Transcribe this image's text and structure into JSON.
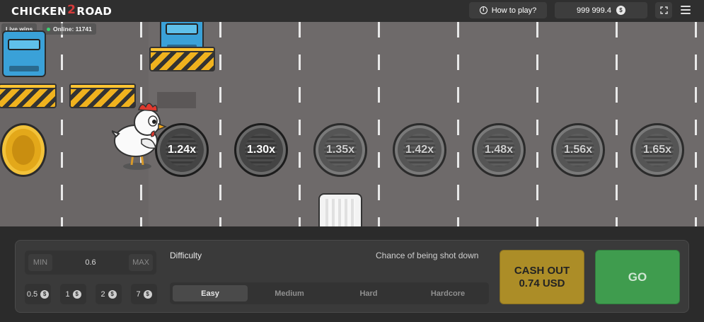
{
  "header": {
    "logo_part1": "CHICKEN",
    "logo_two": "2",
    "logo_part2": "ROAD",
    "how_to_play": "How to play?",
    "balance": "999 999.4",
    "currency_icon": "$"
  },
  "road": {
    "live_wins": "Live wins",
    "online": "Online: 11741",
    "multipliers": [
      "1.24x",
      "1.30x",
      "1.35x",
      "1.42x",
      "1.48x",
      "1.56x",
      "1.65x"
    ]
  },
  "panel": {
    "min_label": "MIN",
    "bet_value": "0.6",
    "max_label": "MAX",
    "quick_bets": [
      "0.5",
      "1",
      "2",
      "7"
    ],
    "difficulty_title": "Difficulty",
    "chance_label": "Chance of being shot down",
    "difficulties": [
      "Easy",
      "Medium",
      "Hard",
      "Hardcore"
    ],
    "selected_difficulty": "Easy",
    "cashout_line1": "CASH OUT",
    "cashout_line2": "0.74 USD",
    "go_label": "GO"
  },
  "colors": {
    "road": "#6e6a6a",
    "cashout": "#b39227",
    "go": "#3f9c4e",
    "online_dot": "#3bd16f"
  }
}
